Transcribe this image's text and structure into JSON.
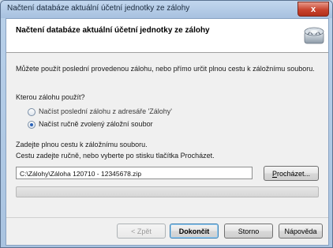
{
  "window": {
    "title": "Načtení databáze aktuální účetní jednotky ze zálohy",
    "close_label": "x"
  },
  "header": {
    "title": "Načtení databáze aktuální účetní jednotky ze zálohy",
    "icon": "database-restore-icon"
  },
  "intro_text": "Můžete použít poslední provedenou zálohu, nebo přímo určit plnou cestu k záložnímu souboru.",
  "question_label": "Kterou zálohu použít?",
  "options": [
    {
      "label": "Načíst poslední zálohu z adresáře 'Zálohy'",
      "selected": false
    },
    {
      "label": "Načíst ručně zvolený záložní soubor",
      "selected": true
    }
  ],
  "path_instructions": [
    "Zadejte plnou cestu k záložnímu souboru.",
    "Cestu zadejte ručně, nebo vyberte po stisku tlačítka Procházet."
  ],
  "path_input": {
    "value": "C:\\Zálohy\\Záloha 120710 - 12345678.zip"
  },
  "browse_button": {
    "label_hot": "P",
    "label_rest": "rocházet..."
  },
  "progress": {
    "value": 0
  },
  "footer": {
    "back_label": "< Zpět",
    "finish_label": "Dokončit",
    "cancel_label": "Storno",
    "help_label": "Nápověda"
  },
  "colors": {
    "accent": "#2b63b8",
    "close_button": "#c8442f",
    "title_bar": "#b9d1ea"
  }
}
